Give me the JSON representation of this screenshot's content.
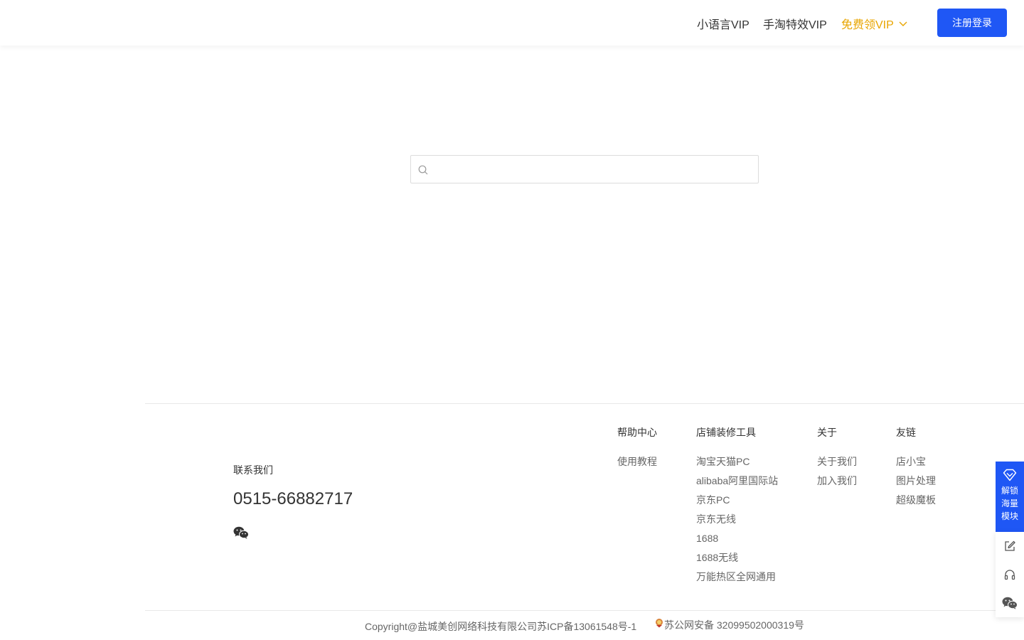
{
  "nav": {
    "items": [
      {
        "label": "小语言VIP"
      },
      {
        "label": "手淘特效VIP"
      }
    ],
    "free_vip": {
      "label": "免费领VIP",
      "color": "#e8a500"
    },
    "login_button": "注册登录",
    "accent_color": "#1f57f5"
  },
  "search": {
    "placeholder": "",
    "value": ""
  },
  "footer": {
    "contact": {
      "label": "联系我们",
      "phone": "0515-66882717",
      "icon": "wechat-icon"
    },
    "columns": [
      {
        "title": "帮助中心",
        "links": [
          "使用教程"
        ]
      },
      {
        "title": "店铺装修工具",
        "links": [
          "淘宝天猫PC",
          "alibaba阿里国际站",
          "京东PC",
          "京东无线",
          "1688",
          "1688无线",
          "万能热区全网通用"
        ]
      },
      {
        "title": "关于",
        "links": [
          "关于我们",
          "加入我们"
        ]
      },
      {
        "title": "友链",
        "links": [
          "店小宝",
          "图片处理",
          "超级魔板"
        ]
      }
    ],
    "copyright": "Copyright@盐城美创网络科技有限公司苏ICP备13061548号-1",
    "police_record": "苏公网安备 32099502000319号"
  },
  "sidebar": {
    "unlock_label": "解锁海量模块",
    "tools": [
      "edit-icon",
      "headset-icon",
      "wechat-icon"
    ]
  }
}
